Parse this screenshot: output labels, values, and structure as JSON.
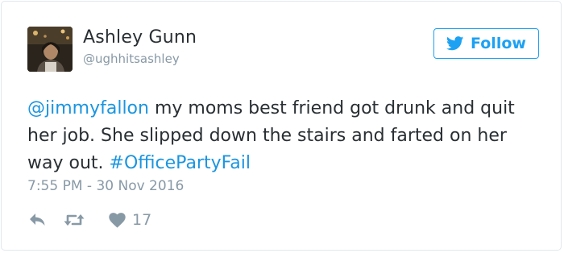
{
  "author": {
    "name": "Ashley Gunn",
    "handle": "@ughhitsashley",
    "avatar_icon": "profile-photo"
  },
  "follow_button": {
    "label": "Follow",
    "icon": "twitter-bird-icon"
  },
  "tweet": {
    "segments": [
      {
        "text": "@jimmyfallon",
        "type": "mention"
      },
      {
        "text": " my moms best friend got drunk and quit her job. She slipped down the stairs and farted on her way out. ",
        "type": "text"
      },
      {
        "text": "#OfficePartyFail",
        "type": "hashtag"
      }
    ],
    "timestamp": "7:55 PM - 30 Nov 2016"
  },
  "actions": {
    "reply_icon": "reply-icon",
    "retweet_icon": "retweet-icon",
    "like_icon": "heart-icon",
    "like_count": "17"
  },
  "colors": {
    "accent": "#1da1f2",
    "link": "#1b95e0",
    "text": "#292f33",
    "muted": "#8899a6",
    "border": "#e1e8ed"
  }
}
